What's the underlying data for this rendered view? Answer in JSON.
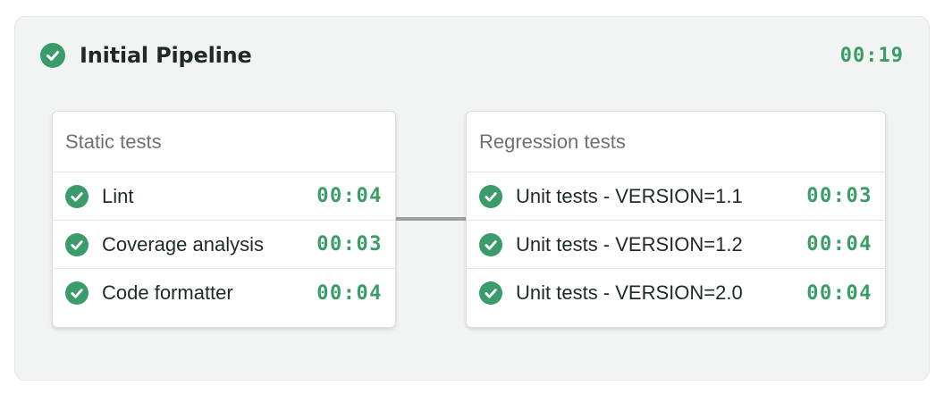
{
  "pipeline": {
    "title": "Initial Pipeline",
    "duration": "00:19",
    "status_icon": "check-circle-icon",
    "status_color": "#3c9b6a"
  },
  "blocks": [
    {
      "title": "Static tests",
      "jobs": [
        {
          "name": "Lint",
          "duration": "00:04",
          "status": "passed"
        },
        {
          "name": "Coverage analysis",
          "duration": "00:03",
          "status": "passed"
        },
        {
          "name": "Code formatter",
          "duration": "00:04",
          "status": "passed"
        }
      ]
    },
    {
      "title": "Regression tests",
      "jobs": [
        {
          "name": "Unit tests - VERSION=1.1",
          "duration": "00:03",
          "status": "passed"
        },
        {
          "name": "Unit tests - VERSION=1.2",
          "duration": "00:04",
          "status": "passed"
        },
        {
          "name": "Unit tests - VERSION=2.0",
          "duration": "00:04",
          "status": "passed"
        }
      ]
    }
  ],
  "colors": {
    "accent": "#3a9c66",
    "background": "#f2f4f3",
    "connector": "#9aa29f"
  }
}
